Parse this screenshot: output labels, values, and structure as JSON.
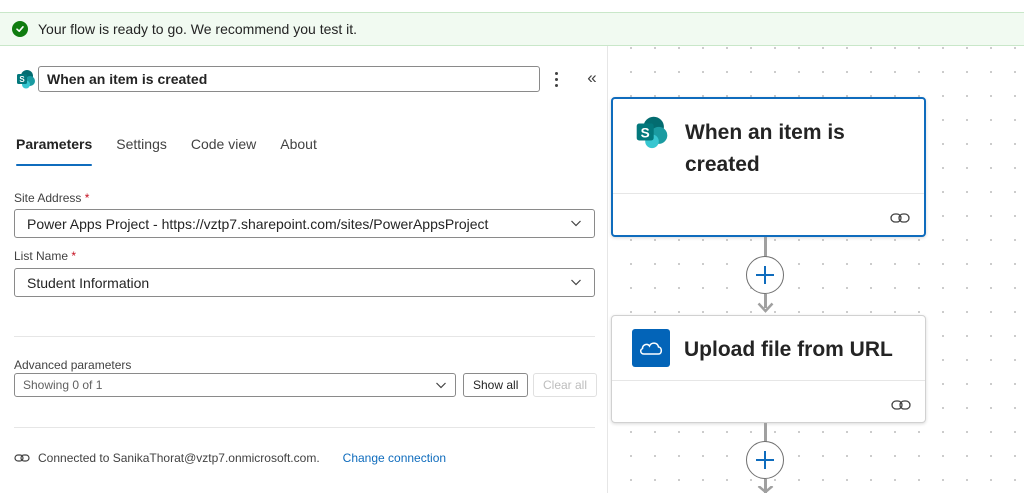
{
  "banner": {
    "text": "Your flow is ready to go. We recommend you test it."
  },
  "panel": {
    "title_value": "When an item is created",
    "tabs": [
      {
        "label": "Parameters",
        "active": true
      },
      {
        "label": "Settings",
        "active": false
      },
      {
        "label": "Code view",
        "active": false
      },
      {
        "label": "About",
        "active": false
      }
    ],
    "site_address": {
      "label": "Site Address",
      "required_mark": "*",
      "value": "Power Apps Project - https://vztp7.sharepoint.com/sites/PowerAppsProject"
    },
    "list_name": {
      "label": "List Name",
      "required_mark": "*",
      "value": "Student Information"
    },
    "advanced": {
      "label": "Advanced parameters",
      "select_value": "Showing 0 of 1",
      "show_all": "Show all",
      "clear_all": "Clear all"
    },
    "connection": {
      "text": "Connected to SanikaThorat@vztp7.onmicrosoft.com.",
      "change_link": "Change connection"
    }
  },
  "canvas": {
    "cards": [
      {
        "title": "When an item is created",
        "icon": "sharepoint-icon"
      },
      {
        "title": "Upload file from URL",
        "icon": "onedrive-icon"
      }
    ]
  },
  "colors": {
    "accent": "#0f6cbd",
    "success": "#107c10",
    "sharepoint_teal": "#038387",
    "onedrive_blue": "#0364b8"
  }
}
